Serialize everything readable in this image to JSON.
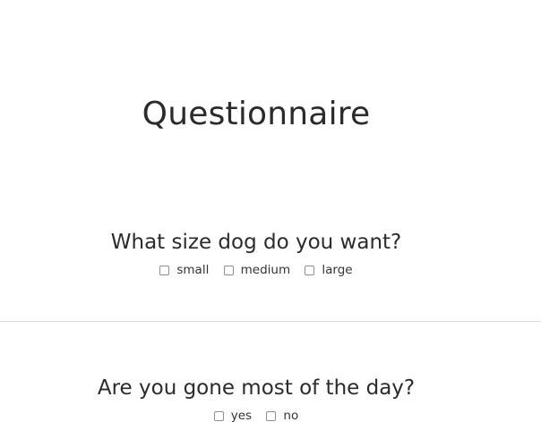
{
  "page": {
    "title": "Questionnaire"
  },
  "questions": [
    {
      "text": "What size dog do you want?",
      "options": [
        "small",
        "medium",
        "large"
      ]
    },
    {
      "text": "Are you gone most of the day?",
      "options": [
        "yes",
        "no"
      ]
    }
  ]
}
